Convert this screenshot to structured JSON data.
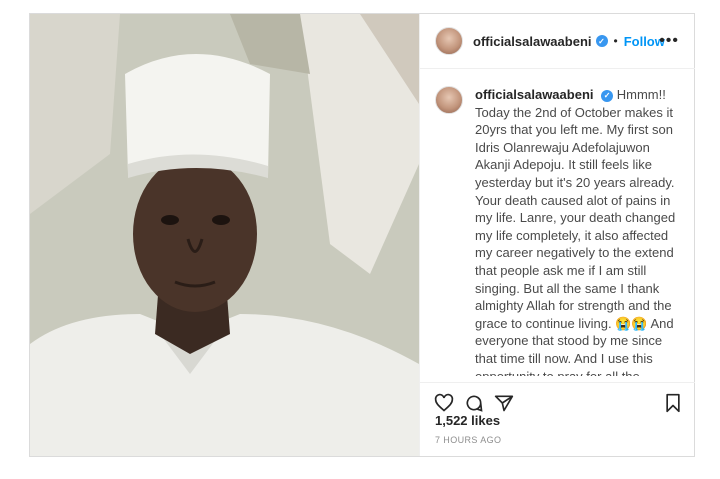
{
  "post": {
    "username": "officialsalawaabeni",
    "follow_label": "Follow",
    "more_icon": "more-options-icon",
    "caption_html_parts": [
      "Hmmm!! Today the 2nd of October makes it 20yrs that you left me. My first son Idris Olanrewaju Adefolajuwon Akanji Adepoju. It still feels like yesterday but it's 20 years already. Your death caused alot of pains in my life. Lanre, your death changed my life completely, it also affected my career negatively to the extend that people ask me if I am still singing. But all the same I thank almighty Allah for strength and the grace to continue living. 😭😭 And everyone that stood by me since that time till now. And I use this opportunity to pray for all the parents out there \"ENI RI IKU OMO NI AGBARA OLOHUN O\" 🙏🙏🙏🙏 and to the ones that have experienced it, \"IDUNNU TON POPU IBANUJE NI"
    ],
    "likes": "1,522 likes",
    "time_ago": "7 HOURS AGO",
    "accent_color": "#0095f6"
  }
}
